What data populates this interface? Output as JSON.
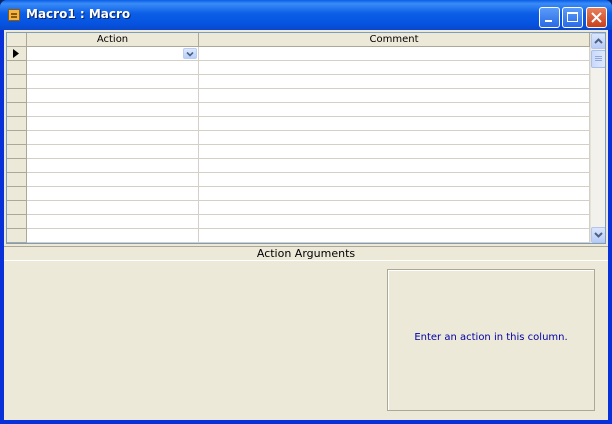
{
  "window": {
    "title": "Macro1 : Macro"
  },
  "grid": {
    "columns": [
      {
        "label": "Action"
      },
      {
        "label": "Comment"
      }
    ],
    "row_count": 14,
    "current_row": 0
  },
  "arguments_pane": {
    "title": "Action Arguments",
    "hint": "Enter an action in this column."
  },
  "colors": {
    "titlebar": "#0553e0",
    "hint_text": "#0000a8",
    "pane_bg": "#ece9d8"
  }
}
